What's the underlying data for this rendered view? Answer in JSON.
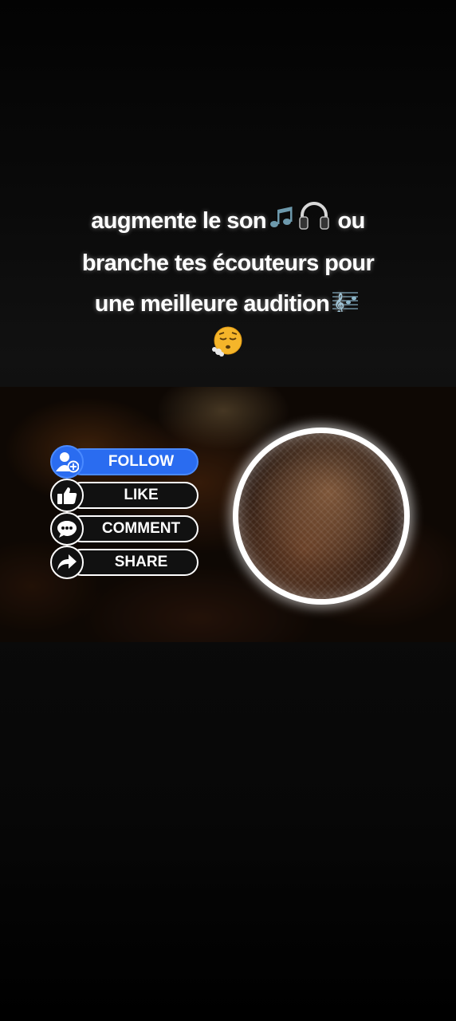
{
  "caption": {
    "line1_a": "augmente le son",
    "line1_b": "ou",
    "line2": "branche tes écouteurs pour",
    "line3": "une meilleure audition"
  },
  "social_buttons": [
    {
      "label": "FOLLOW",
      "icon": "add-user-icon",
      "color": "#2a6cf0"
    },
    {
      "label": "LIKE",
      "icon": "thumbs-up-icon",
      "color": "#111111"
    },
    {
      "label": "COMMENT",
      "icon": "comment-icon",
      "color": "#111111"
    },
    {
      "label": "SHARE",
      "icon": "share-arrow-icon",
      "color": "#111111"
    }
  ],
  "visualizer": {
    "icon": "audio-visualizer-orb"
  },
  "colors": {
    "accent_blue": "#2a6cf0",
    "background": "#000000"
  }
}
